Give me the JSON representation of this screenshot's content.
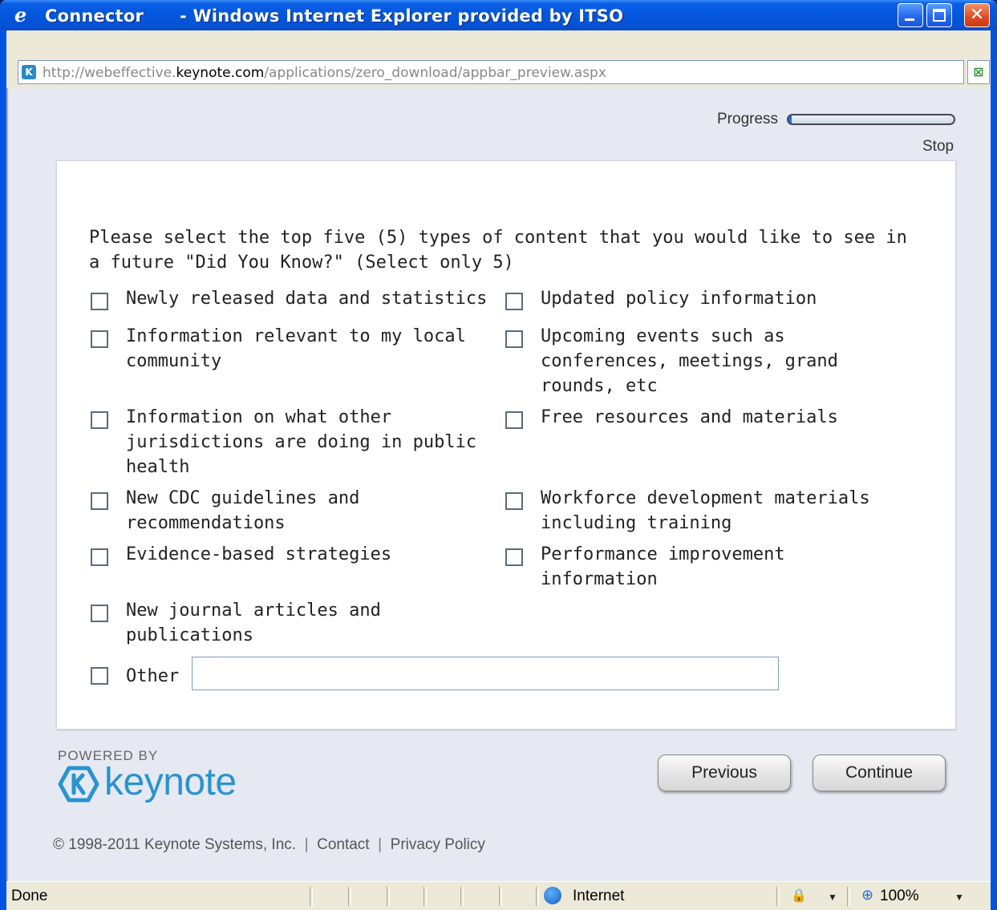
{
  "window": {
    "title": "Connector      - Windows Internet Explorer provided by ITSO"
  },
  "address": {
    "url_prefix": "http://webeffective.",
    "url_domain": "keynote.com",
    "url_path": "/applications/zero_download/appbar_preview.aspx"
  },
  "progress": {
    "label": "Progress",
    "value_percent": 2,
    "stop_label": "Stop"
  },
  "question": {
    "text": "Please select the top five (5) types of content that you would like to see in a future \"Did You Know?\" (Select only 5)"
  },
  "options": [
    {
      "label": "Newly released data and statistics",
      "checked": false
    },
    {
      "label": "Updated policy information",
      "checked": false
    },
    {
      "label": "Information relevant to my local\ncommunity",
      "checked": false
    },
    {
      "label": "Upcoming events such as\nconferences, meetings, grand\nrounds, etc",
      "checked": false
    },
    {
      "label": "Information on what other\njurisdictions are doing in public\nhealth",
      "checked": false
    },
    {
      "label": "Free resources and materials",
      "checked": false
    },
    {
      "label": "New CDC guidelines and\nrecommendations",
      "checked": false
    },
    {
      "label": "Workforce development materials\nincluding training",
      "checked": false
    },
    {
      "label": "Evidence-based strategies",
      "checked": false
    },
    {
      "label": "Performance improvement\ninformation",
      "checked": false
    },
    {
      "label": "New journal articles and\npublications",
      "checked": false
    },
    {
      "label": "Other",
      "checked": false
    }
  ],
  "other_input": {
    "value": ""
  },
  "branding": {
    "powered_by": "POWERED BY",
    "logo_text": "keynote",
    "logo_color": "#2a93d0"
  },
  "nav": {
    "previous_label": "Previous",
    "continue_label": "Continue"
  },
  "footer": {
    "copyright": "© 1998-2011 Keynote Systems, Inc.",
    "separator": "|",
    "contact": "Contact",
    "privacy": "Privacy Policy"
  },
  "status": {
    "text": "Done",
    "zone": "Internet",
    "zoom": "100%"
  }
}
